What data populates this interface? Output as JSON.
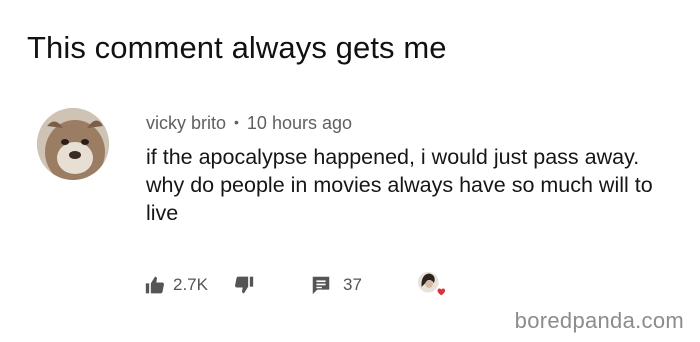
{
  "meme": {
    "title": "This comment always gets me"
  },
  "comment": {
    "author": "vicky brito",
    "separator": "•",
    "timestamp": "10 hours ago",
    "text": "if the apocalypse happened, i would just pass away. why do people in movies always have so much will to live",
    "like_count": "2.7K",
    "reply_count": "37"
  },
  "watermark": "boredpanda.com",
  "colors": {
    "meta_text": "#606060",
    "icon_gray": "#555555",
    "heart_red": "#d9343a"
  },
  "icons": {
    "like": "thumbs-up-icon",
    "dislike": "thumbs-down-icon",
    "reply": "comment-icon",
    "creator_heart": "creator-heart-icon"
  }
}
